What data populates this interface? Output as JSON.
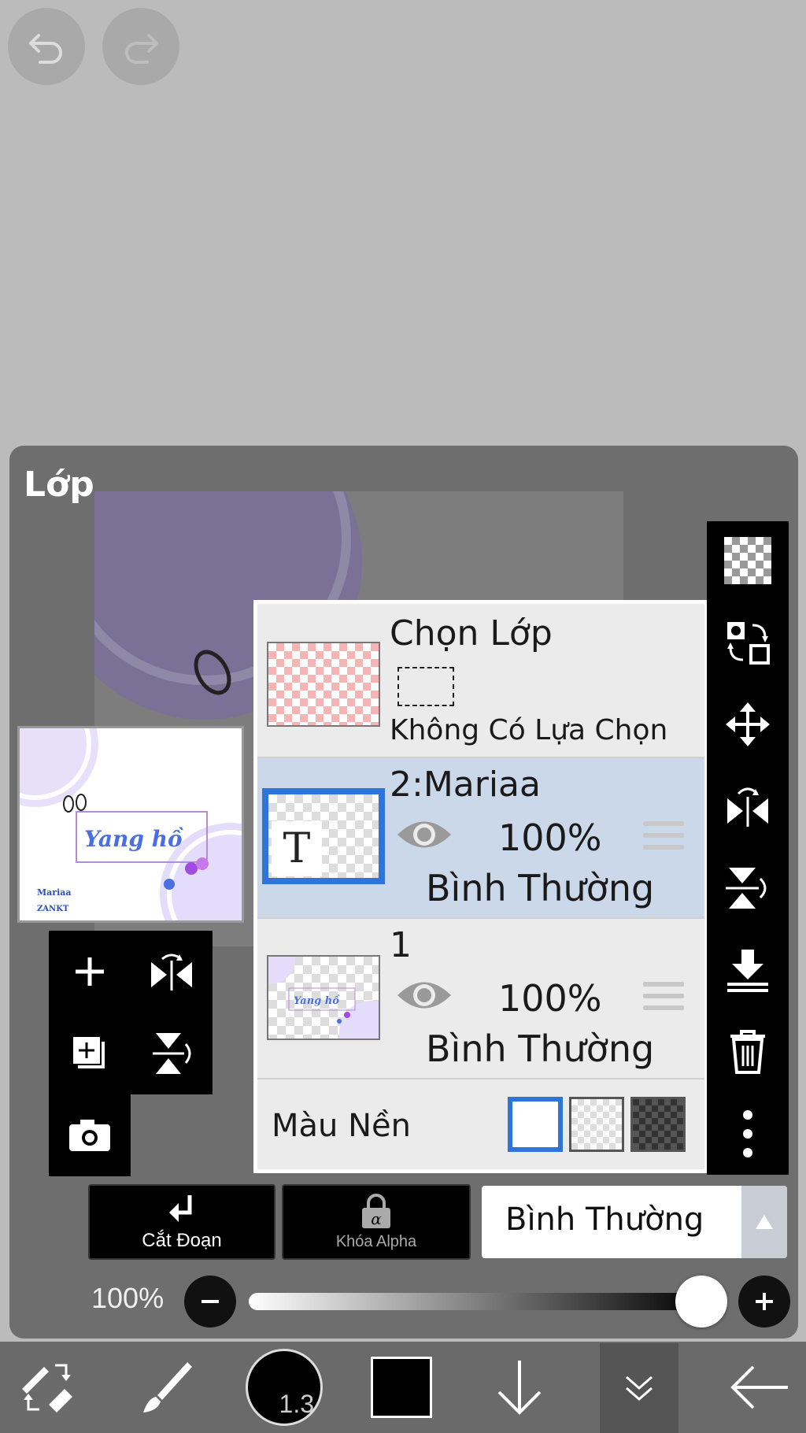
{
  "top": {
    "undo_icon": "undo-icon",
    "redo_icon": "redo-icon"
  },
  "panel": {
    "title": "Lớp",
    "selection_layer": {
      "title": "Chọn Lớp",
      "status": "Không Có Lựa Chọn"
    },
    "layers": [
      {
        "name": "2:Mariaa",
        "opacity": "100%",
        "blend": "Bình Thường",
        "selected": true,
        "type": "text"
      },
      {
        "name": "1",
        "opacity": "100%",
        "blend": "Bình Thường",
        "selected": false,
        "type": "image"
      }
    ],
    "background": {
      "label": "Màu Nền",
      "options": [
        "white",
        "transparent",
        "dark-checker"
      ],
      "selected": "white"
    },
    "thumbnail_text": {
      "main": "Yang hồ",
      "bottom_left": "Mariaa",
      "bottom_left2": "ZANKT"
    }
  },
  "actions": {
    "clipping_label": "Cắt Đoạn",
    "alpha_lock_label": "Khóa Alpha",
    "blend_mode": "Bình Thường"
  },
  "opacity": {
    "label": "100%",
    "value": 1.0
  },
  "toolbar": {
    "brush_size": "1.3",
    "color": "#000000"
  },
  "colors": {
    "accent": "#2f74d8",
    "selected_row": "#cbd8ea"
  }
}
